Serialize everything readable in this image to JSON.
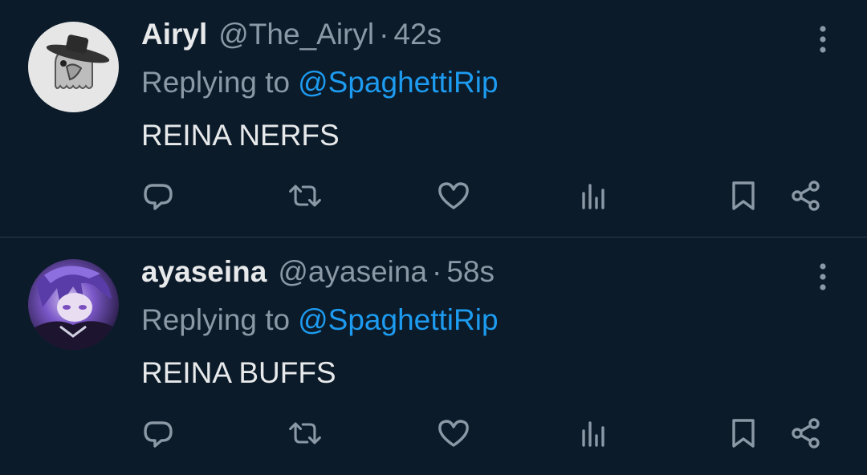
{
  "tweets": [
    {
      "display_name": "Airyl",
      "handle": "@The_Airyl",
      "separator": "·",
      "time": "42s",
      "replying_prefix": "Replying to",
      "replying_to": "@SpaghettiRip",
      "text": "REINA NERFS",
      "avatar_icon": "plague-doctor-ghost-avatar"
    },
    {
      "display_name": "ayaseina",
      "handle": "@ayaseina",
      "separator": "·",
      "time": "58s",
      "replying_prefix": "Replying to",
      "replying_to": "@SpaghettiRip",
      "text": "REINA BUFFS",
      "avatar_icon": "anime-character-avatar"
    }
  ],
  "actions": [
    "reply-icon",
    "retweet-icon",
    "like-icon",
    "views-icon",
    "bookmark-icon",
    "share-icon"
  ],
  "colors": {
    "background": "#0b1b2a",
    "primary_text": "#e7e9ea",
    "secondary_text": "#8b98a5",
    "link": "#1d9bf0",
    "divider": "#2f3b47"
  }
}
